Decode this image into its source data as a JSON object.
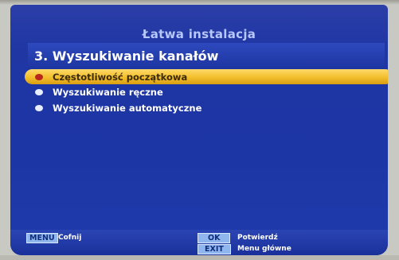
{
  "header": {
    "title": "Łatwa instalacja",
    "subtitle": "3. Wyszukiwanie kanałów"
  },
  "menu": {
    "items": [
      {
        "label": "Częstotliwość początkowa",
        "selected": true
      },
      {
        "label": "Wyszukiwanie ręczne",
        "selected": false
      },
      {
        "label": "Wyszukiwanie automatyczne",
        "selected": false
      }
    ]
  },
  "footer": {
    "menu_key": "MENU",
    "menu_hint": "Cofnij",
    "ok_key": "OK",
    "ok_hint": "Potwierdź",
    "exit_key": "EXIT",
    "exit_hint": "Menu główne"
  },
  "colors": {
    "screen_bg": "#1d36a6",
    "highlight": "#f2be2c",
    "selected_bullet": "#b8261c",
    "bullet": "#e6eeff"
  }
}
